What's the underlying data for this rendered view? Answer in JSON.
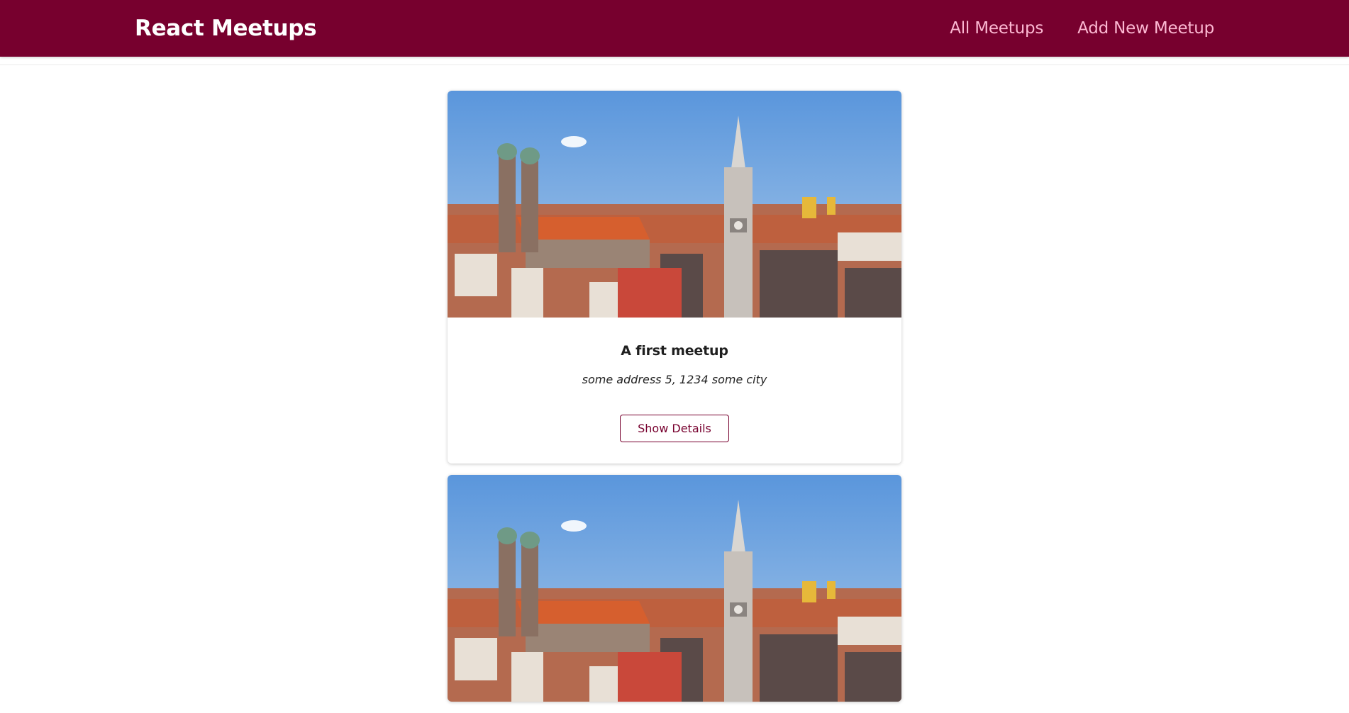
{
  "header": {
    "logo": "React Meetups",
    "nav": [
      {
        "label": "All Meetups"
      },
      {
        "label": "Add New Meetup"
      }
    ],
    "colors": {
      "background": "#77002e",
      "nav_link": "#fcb8d2",
      "logo": "#ffffff"
    }
  },
  "meetups": [
    {
      "title": "A first meetup",
      "address": "some address 5, 1234 some city",
      "button_label": "Show Details",
      "image_icon": "city-skyline-photo"
    },
    {
      "title": "",
      "address": "",
      "button_label": "",
      "image_icon": "city-skyline-photo"
    }
  ]
}
